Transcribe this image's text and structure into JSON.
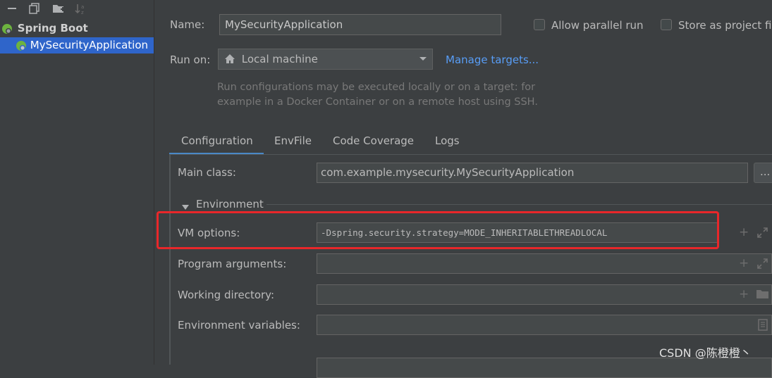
{
  "toolbar": {
    "icons": [
      "minus-icon",
      "copy-icon",
      "folder-add-icon",
      "sort-icon"
    ]
  },
  "tree": {
    "group_label": "Spring Boot",
    "items": [
      {
        "label": "MySecurityApplication",
        "selected": true
      }
    ]
  },
  "config": {
    "name_label": "Name:",
    "name_value": "MySecurityApplication",
    "allow_parallel_label": "Allow parallel run",
    "store_as_project_label": "Store as project fil",
    "run_on_label": "Run on:",
    "run_on_value": "Local machine",
    "manage_targets_label": "Manage targets...",
    "hint_line1": "Run configurations may be executed locally or on a target: for",
    "hint_line2": "example in a Docker Container or on a remote host using SSH."
  },
  "tabs": [
    {
      "label": "Configuration",
      "active": true
    },
    {
      "label": "EnvFile",
      "active": false
    },
    {
      "label": "Code Coverage",
      "active": false
    },
    {
      "label": "Logs",
      "active": false
    }
  ],
  "form": {
    "main_class_label": "Main class:",
    "main_class_value": "com.example.mysecurity.MySecurityApplication",
    "browse_label": "...",
    "environment_label": "Environment",
    "vm_options_label": "VM options:",
    "vm_options_value": "-Dspring.security.strategy=MODE_INHERITABLETHREADLOCAL",
    "program_args_label": "Program arguments:",
    "working_dir_label": "Working directory:",
    "env_vars_label": "Environment variables:"
  },
  "watermark": "CSDN @陈橙橙丶",
  "colors": {
    "background": "#3c3f41",
    "selection": "#2f65ca",
    "link": "#589df6",
    "highlight_box": "#e8272a",
    "tab_underline": "#4a88c7"
  }
}
